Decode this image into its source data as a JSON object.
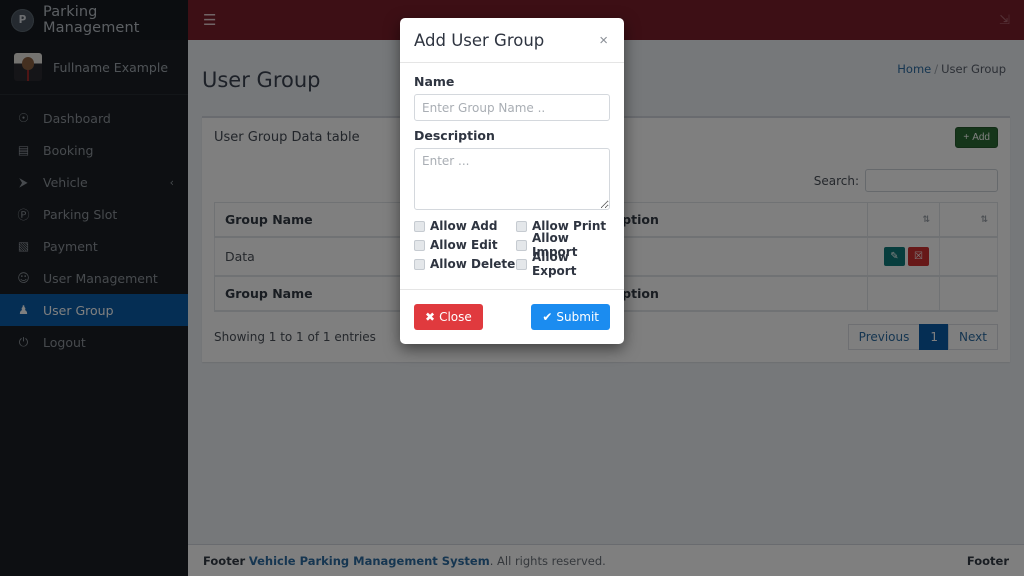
{
  "sidebar": {
    "brand": {
      "logo_text": "P",
      "title": "Parking Management"
    },
    "user": {
      "name": "Fullname Example"
    },
    "items": [
      {
        "label": "Dashboard",
        "icon": "dashboard-icon",
        "glyph": "☉",
        "active": false,
        "caret": ""
      },
      {
        "label": "Booking",
        "icon": "booking-book-icon",
        "glyph": "▤",
        "active": false,
        "caret": ""
      },
      {
        "label": "Vehicle",
        "icon": "car-icon",
        "glyph": "⮞",
        "active": false,
        "caret": "‹"
      },
      {
        "label": "Parking Slot",
        "icon": "parking-p-icon",
        "glyph": "Ⓟ",
        "active": false,
        "caret": ""
      },
      {
        "label": "Payment",
        "icon": "money-bill-icon",
        "glyph": "▧",
        "active": false,
        "caret": ""
      },
      {
        "label": "User Management",
        "icon": "users-cog-icon",
        "glyph": "☺",
        "active": false,
        "caret": ""
      },
      {
        "label": "User Group",
        "icon": "user-group-icon",
        "glyph": "♟",
        "active": true,
        "caret": ""
      },
      {
        "label": "Logout",
        "icon": "power-off-icon",
        "glyph": "⏻",
        "active": false,
        "caret": ""
      }
    ]
  },
  "navbar": {
    "toggle_icon": "hamburger-menu-icon",
    "toggle_glyph": "☰",
    "expand_icon": "compress-arrows-icon",
    "expand_glyph": "⇲"
  },
  "page": {
    "title": "User Group",
    "breadcrumb": {
      "home": "Home",
      "separator": "/",
      "current": "User Group"
    }
  },
  "box": {
    "title": "User Group Data table",
    "add_button": {
      "label": "Add",
      "icon": "plus-icon",
      "glyph": "+"
    }
  },
  "datatable": {
    "search_label": "Search:",
    "search_value": "",
    "search_placeholder": "",
    "columns": [
      {
        "label": "Group Name",
        "sort_icon": "sort-updown-icon"
      },
      {
        "label": "Description",
        "sort_icon": "sort-updown-icon"
      },
      {
        "label": "",
        "sort_icon": "sort-updown-icon"
      },
      {
        "label": "",
        "sort_icon": "sort-updown-icon"
      }
    ],
    "sort_glyph": "⇅",
    "rows": [
      {
        "group_name": "Data",
        "description": "",
        "edit_icon": "pencil-edit-icon",
        "edit_glyph": "✎",
        "delete_icon": "trash-delete-icon",
        "delete_glyph": "Ὕ1"
      }
    ],
    "footer_columns": [
      "Group Name",
      "Description",
      "",
      ""
    ],
    "info": "Showing 1 to 1 of 1 entries",
    "pagination": {
      "previous": "Previous",
      "pages": [
        "1"
      ],
      "current": "1",
      "next": "Next"
    }
  },
  "footer": {
    "prefix": "Footer",
    "link": "Vehicle Parking Management System",
    "suffix": ". All rights reserved.",
    "right": "Footer"
  },
  "modal": {
    "title": "Add User Group",
    "close_icon": "close-x-icon",
    "close_glyph": "×",
    "fields": {
      "name_label": "Name",
      "name_value": "",
      "name_placeholder": "Enter Group Name ..",
      "description_label": "Description",
      "description_value": "",
      "description_placeholder": "Enter ..."
    },
    "permissions": [
      {
        "label": "Allow Add",
        "checked": false
      },
      {
        "label": "Allow Print",
        "checked": false
      },
      {
        "label": "Allow Edit",
        "checked": false
      },
      {
        "label": "Allow Import",
        "checked": false
      },
      {
        "label": "Allow Delete",
        "checked": false
      },
      {
        "label": "Allow Export",
        "checked": false
      }
    ],
    "buttons": {
      "close": {
        "label": "Close",
        "icon": "times-icon",
        "glyph": "✖"
      },
      "submit": {
        "label": "Submit",
        "icon": "check-icon",
        "glyph": "✔"
      }
    }
  },
  "colors": {
    "navbar": "#7a1f2b",
    "sidebar": "#1a1f24",
    "active_item": "#0a5ca8",
    "add_button": "#2b6b35",
    "edit_button": "#0f7b7b",
    "delete_button": "#cf3030",
    "submit_button": "#1b8cf0",
    "close_button": "#e03a3e",
    "link": "#2d6ca2"
  }
}
